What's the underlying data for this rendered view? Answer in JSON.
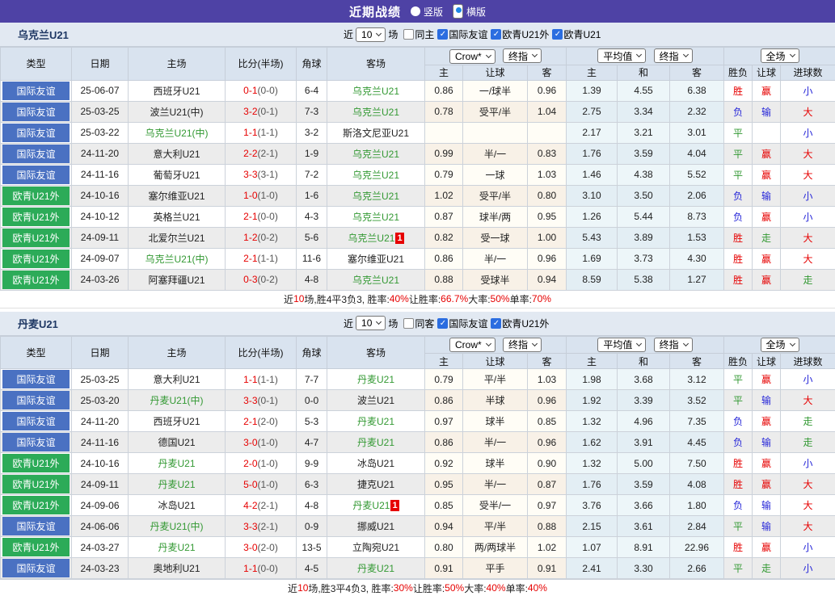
{
  "header": {
    "title": "近期战绩",
    "radio_vertical": "竖版",
    "radio_horizontal": "横版"
  },
  "controls": {
    "crow": "Crow*",
    "final_odds": "终指",
    "average": "平均值",
    "full_match": "全场"
  },
  "columns": {
    "type": "类型",
    "date": "日期",
    "home": "主场",
    "score": "比分(半场)",
    "corner": "角球",
    "away": "客场",
    "odds_home": "主",
    "odds_handicap": "让球",
    "odds_away": "客",
    "avg_home": "主",
    "avg_draw": "和",
    "avg_away": "客",
    "result_wdl": "胜负",
    "result_handicap": "让球",
    "result_goals": "进球数"
  },
  "colors": {
    "accent_purple": "#4e42a5",
    "type_blue": "#4a71c2",
    "type_green": "#2cab58",
    "focus_team_green": "#339933",
    "score_red": "#e60000",
    "result_red": "#e60000",
    "result_blue": "#2626d8",
    "result_green": "#339933",
    "header_bg": "#d9e3ef"
  },
  "tables": [
    {
      "team": "乌克兰U21",
      "filters": {
        "prefix": "近",
        "count": "10",
        "suffix": "场",
        "checks": [
          {
            "label": "同主",
            "checked": false
          },
          {
            "label": "国际友谊",
            "checked": true
          },
          {
            "label": "欧青U21外",
            "checked": true
          },
          {
            "label": "欧青U21",
            "checked": true
          }
        ]
      },
      "rows": [
        {
          "type": "国际友谊",
          "type_style": "blue",
          "date": "25-06-07",
          "home": "西班牙U21",
          "home_focus": false,
          "home_card": "",
          "score": "0-1",
          "half": "(0-0)",
          "corner": "6-4",
          "away": "乌克兰U21",
          "away_focus": true,
          "away_card": "",
          "crow_home": "0.86",
          "crow_hcp": "一/球半",
          "crow_away": "0.96",
          "avg_home": "1.39",
          "avg_draw": "4.55",
          "avg_away": "6.38",
          "wdl": "胜",
          "wdl_c": "r",
          "hcp": "赢",
          "hcp_c": "r",
          "goal": "小",
          "goal_c": "b"
        },
        {
          "type": "国际友谊",
          "type_style": "blue",
          "date": "25-03-25",
          "home": "波兰U21(中)",
          "home_focus": false,
          "home_card": "",
          "score": "3-2",
          "half": "(0-1)",
          "corner": "7-3",
          "away": "乌克兰U21",
          "away_focus": true,
          "away_card": "",
          "crow_home": "0.78",
          "crow_hcp": "受平/半",
          "crow_away": "1.04",
          "avg_home": "2.75",
          "avg_draw": "3.34",
          "avg_away": "2.32",
          "wdl": "负",
          "wdl_c": "b",
          "hcp": "输",
          "hcp_c": "b",
          "goal": "大",
          "goal_c": "r"
        },
        {
          "type": "国际友谊",
          "type_style": "blue",
          "date": "25-03-22",
          "home": "乌克兰U21(中)",
          "home_focus": true,
          "home_card": "",
          "score": "1-1",
          "half": "(1-1)",
          "corner": "3-2",
          "away": "斯洛文尼亚U21",
          "away_focus": false,
          "away_card": "",
          "crow_home": "",
          "crow_hcp": "",
          "crow_away": "",
          "avg_home": "2.17",
          "avg_draw": "3.21",
          "avg_away": "3.01",
          "wdl": "平",
          "wdl_c": "g",
          "hcp": "",
          "hcp_c": "r",
          "goal": "小",
          "goal_c": "b"
        },
        {
          "type": "国际友谊",
          "type_style": "blue",
          "date": "24-11-20",
          "home": "意大利U21",
          "home_focus": false,
          "home_card": "",
          "score": "2-2",
          "half": "(2-1)",
          "corner": "1-9",
          "away": "乌克兰U21",
          "away_focus": true,
          "away_card": "",
          "crow_home": "0.99",
          "crow_hcp": "半/一",
          "crow_away": "0.83",
          "avg_home": "1.76",
          "avg_draw": "3.59",
          "avg_away": "4.04",
          "wdl": "平",
          "wdl_c": "g",
          "hcp": "赢",
          "hcp_c": "r",
          "goal": "大",
          "goal_c": "r"
        },
        {
          "type": "国际友谊",
          "type_style": "blue",
          "date": "24-11-16",
          "home": "葡萄牙U21",
          "home_focus": false,
          "home_card": "",
          "score": "3-3",
          "half": "(3-1)",
          "corner": "7-2",
          "away": "乌克兰U21",
          "away_focus": true,
          "away_card": "",
          "crow_home": "0.79",
          "crow_hcp": "一球",
          "crow_away": "1.03",
          "avg_home": "1.46",
          "avg_draw": "4.38",
          "avg_away": "5.52",
          "wdl": "平",
          "wdl_c": "g",
          "hcp": "赢",
          "hcp_c": "r",
          "goal": "大",
          "goal_c": "r"
        },
        {
          "type": "欧青U21外",
          "type_style": "green",
          "date": "24-10-16",
          "home": "塞尔维亚U21",
          "home_focus": false,
          "home_card": "",
          "score": "1-0",
          "half": "(1-0)",
          "corner": "1-6",
          "away": "乌克兰U21",
          "away_focus": true,
          "away_card": "",
          "crow_home": "1.02",
          "crow_hcp": "受平/半",
          "crow_away": "0.80",
          "avg_home": "3.10",
          "avg_draw": "3.50",
          "avg_away": "2.06",
          "wdl": "负",
          "wdl_c": "b",
          "hcp": "输",
          "hcp_c": "b",
          "goal": "小",
          "goal_c": "b"
        },
        {
          "type": "欧青U21外",
          "type_style": "green",
          "date": "24-10-12",
          "home": "英格兰U21",
          "home_focus": false,
          "home_card": "",
          "score": "2-1",
          "half": "(0-0)",
          "corner": "4-3",
          "away": "乌克兰U21",
          "away_focus": true,
          "away_card": "",
          "crow_home": "0.87",
          "crow_hcp": "球半/两",
          "crow_away": "0.95",
          "avg_home": "1.26",
          "avg_draw": "5.44",
          "avg_away": "8.73",
          "wdl": "负",
          "wdl_c": "b",
          "hcp": "赢",
          "hcp_c": "r",
          "goal": "小",
          "goal_c": "b"
        },
        {
          "type": "欧青U21外",
          "type_style": "green",
          "date": "24-09-11",
          "home": "北爱尔兰U21",
          "home_focus": false,
          "home_card": "",
          "score": "1-2",
          "half": "(0-2)",
          "corner": "5-6",
          "away": "乌克兰U21",
          "away_focus": true,
          "away_card": "1",
          "crow_home": "0.82",
          "crow_hcp": "受一球",
          "crow_away": "1.00",
          "avg_home": "5.43",
          "avg_draw": "3.89",
          "avg_away": "1.53",
          "wdl": "胜",
          "wdl_c": "r",
          "hcp": "走",
          "hcp_c": "g",
          "goal": "大",
          "goal_c": "r"
        },
        {
          "type": "欧青U21外",
          "type_style": "green",
          "date": "24-09-07",
          "home": "乌克兰U21(中)",
          "home_focus": true,
          "home_card": "",
          "score": "2-1",
          "half": "(1-1)",
          "corner": "11-6",
          "away": "塞尔维亚U21",
          "away_focus": false,
          "away_card": "",
          "crow_home": "0.86",
          "crow_hcp": "半/一",
          "crow_away": "0.96",
          "avg_home": "1.69",
          "avg_draw": "3.73",
          "avg_away": "4.30",
          "wdl": "胜",
          "wdl_c": "r",
          "hcp": "赢",
          "hcp_c": "r",
          "goal": "大",
          "goal_c": "r"
        },
        {
          "type": "欧青U21外",
          "type_style": "green",
          "date": "24-03-26",
          "home": "阿塞拜疆U21",
          "home_focus": false,
          "home_card": "",
          "score": "0-3",
          "half": "(0-2)",
          "corner": "4-8",
          "away": "乌克兰U21",
          "away_focus": true,
          "away_card": "",
          "crow_home": "0.88",
          "crow_hcp": "受球半",
          "crow_away": "0.94",
          "avg_home": "8.59",
          "avg_draw": "5.38",
          "avg_away": "1.27",
          "wdl": "胜",
          "wdl_c": "r",
          "hcp": "赢",
          "hcp_c": "r",
          "goal": "走",
          "goal_c": "g"
        }
      ],
      "summary": [
        {
          "text": "近"
        },
        {
          "text": "10",
          "red": true
        },
        {
          "text": "场,胜4平3负3, 胜率:"
        },
        {
          "text": "40%",
          "red": true
        },
        {
          "text": " 让胜率:"
        },
        {
          "text": "66.7%",
          "red": true
        },
        {
          "text": " 大率:"
        },
        {
          "text": "50%",
          "red": true
        },
        {
          "text": " 单率:"
        },
        {
          "text": "70%",
          "red": true
        }
      ]
    },
    {
      "team": "丹麦U21",
      "filters": {
        "prefix": "近",
        "count": "10",
        "suffix": "场",
        "checks": [
          {
            "label": "同客",
            "checked": false
          },
          {
            "label": "国际友谊",
            "checked": true
          },
          {
            "label": "欧青U21外",
            "checked": true
          }
        ]
      },
      "rows": [
        {
          "type": "国际友谊",
          "type_style": "blue",
          "date": "25-03-25",
          "home": "意大利U21",
          "home_focus": false,
          "home_card": "",
          "score": "1-1",
          "half": "(1-1)",
          "corner": "7-7",
          "away": "丹麦U21",
          "away_focus": true,
          "away_card": "",
          "crow_home": "0.79",
          "crow_hcp": "平/半",
          "crow_away": "1.03",
          "avg_home": "1.98",
          "avg_draw": "3.68",
          "avg_away": "3.12",
          "wdl": "平",
          "wdl_c": "g",
          "hcp": "赢",
          "hcp_c": "r",
          "goal": "小",
          "goal_c": "b"
        },
        {
          "type": "国际友谊",
          "type_style": "blue",
          "date": "25-03-20",
          "home": "丹麦U21(中)",
          "home_focus": true,
          "home_card": "",
          "score": "3-3",
          "half": "(0-1)",
          "corner": "0-0",
          "away": "波兰U21",
          "away_focus": false,
          "away_card": "",
          "crow_home": "0.86",
          "crow_hcp": "半球",
          "crow_away": "0.96",
          "avg_home": "1.92",
          "avg_draw": "3.39",
          "avg_away": "3.52",
          "wdl": "平",
          "wdl_c": "g",
          "hcp": "输",
          "hcp_c": "b",
          "goal": "大",
          "goal_c": "r"
        },
        {
          "type": "国际友谊",
          "type_style": "blue",
          "date": "24-11-20",
          "home": "西班牙U21",
          "home_focus": false,
          "home_card": "",
          "score": "2-1",
          "half": "(2-0)",
          "corner": "5-3",
          "away": "丹麦U21",
          "away_focus": true,
          "away_card": "",
          "crow_home": "0.97",
          "crow_hcp": "球半",
          "crow_away": "0.85",
          "avg_home": "1.32",
          "avg_draw": "4.96",
          "avg_away": "7.35",
          "wdl": "负",
          "wdl_c": "b",
          "hcp": "赢",
          "hcp_c": "r",
          "goal": "走",
          "goal_c": "g"
        },
        {
          "type": "国际友谊",
          "type_style": "blue",
          "date": "24-11-16",
          "home": "德国U21",
          "home_focus": false,
          "home_card": "",
          "score": "3-0",
          "half": "(1-0)",
          "corner": "4-7",
          "away": "丹麦U21",
          "away_focus": true,
          "away_card": "",
          "crow_home": "0.86",
          "crow_hcp": "半/一",
          "crow_away": "0.96",
          "avg_home": "1.62",
          "avg_draw": "3.91",
          "avg_away": "4.45",
          "wdl": "负",
          "wdl_c": "b",
          "hcp": "输",
          "hcp_c": "b",
          "goal": "走",
          "goal_c": "g"
        },
        {
          "type": "欧青U21外",
          "type_style": "green",
          "date": "24-10-16",
          "home": "丹麦U21",
          "home_focus": true,
          "home_card": "",
          "score": "2-0",
          "half": "(1-0)",
          "corner": "9-9",
          "away": "冰岛U21",
          "away_focus": false,
          "away_card": "",
          "crow_home": "0.92",
          "crow_hcp": "球半",
          "crow_away": "0.90",
          "avg_home": "1.32",
          "avg_draw": "5.00",
          "avg_away": "7.50",
          "wdl": "胜",
          "wdl_c": "r",
          "hcp": "赢",
          "hcp_c": "r",
          "goal": "小",
          "goal_c": "b"
        },
        {
          "type": "欧青U21外",
          "type_style": "green",
          "date": "24-09-11",
          "home": "丹麦U21",
          "home_focus": true,
          "home_card": "",
          "score": "5-0",
          "half": "(1-0)",
          "corner": "6-3",
          "away": "捷克U21",
          "away_focus": false,
          "away_card": "",
          "crow_home": "0.95",
          "crow_hcp": "半/一",
          "crow_away": "0.87",
          "avg_home": "1.76",
          "avg_draw": "3.59",
          "avg_away": "4.08",
          "wdl": "胜",
          "wdl_c": "r",
          "hcp": "赢",
          "hcp_c": "r",
          "goal": "大",
          "goal_c": "r"
        },
        {
          "type": "欧青U21外",
          "type_style": "green",
          "date": "24-09-06",
          "home": "冰岛U21",
          "home_focus": false,
          "home_card": "",
          "score": "4-2",
          "half": "(2-1)",
          "corner": "4-8",
          "away": "丹麦U21",
          "away_focus": true,
          "away_card": "1",
          "crow_home": "0.85",
          "crow_hcp": "受半/一",
          "crow_away": "0.97",
          "avg_home": "3.76",
          "avg_draw": "3.66",
          "avg_away": "1.80",
          "wdl": "负",
          "wdl_c": "b",
          "hcp": "输",
          "hcp_c": "b",
          "goal": "大",
          "goal_c": "r"
        },
        {
          "type": "国际友谊",
          "type_style": "blue",
          "date": "24-06-06",
          "home": "丹麦U21(中)",
          "home_focus": true,
          "home_card": "",
          "score": "3-3",
          "half": "(2-1)",
          "corner": "0-9",
          "away": "挪威U21",
          "away_focus": false,
          "away_card": "",
          "crow_home": "0.94",
          "crow_hcp": "平/半",
          "crow_away": "0.88",
          "avg_home": "2.15",
          "avg_draw": "3.61",
          "avg_away": "2.84",
          "wdl": "平",
          "wdl_c": "g",
          "hcp": "输",
          "hcp_c": "b",
          "goal": "大",
          "goal_c": "r"
        },
        {
          "type": "欧青U21外",
          "type_style": "green",
          "date": "24-03-27",
          "home": "丹麦U21",
          "home_focus": true,
          "home_card": "",
          "score": "3-0",
          "half": "(2-0)",
          "corner": "13-5",
          "away": "立陶宛U21",
          "away_focus": false,
          "away_card": "",
          "crow_home": "0.80",
          "crow_hcp": "两/两球半",
          "crow_away": "1.02",
          "avg_home": "1.07",
          "avg_draw": "8.91",
          "avg_away": "22.96",
          "wdl": "胜",
          "wdl_c": "r",
          "hcp": "赢",
          "hcp_c": "r",
          "goal": "小",
          "goal_c": "b"
        },
        {
          "type": "国际友谊",
          "type_style": "blue",
          "date": "24-03-23",
          "home": "奥地利U21",
          "home_focus": false,
          "home_card": "",
          "score": "1-1",
          "half": "(0-0)",
          "corner": "4-5",
          "away": "丹麦U21",
          "away_focus": true,
          "away_card": "",
          "crow_home": "0.91",
          "crow_hcp": "平手",
          "crow_away": "0.91",
          "avg_home": "2.41",
          "avg_draw": "3.30",
          "avg_away": "2.66",
          "wdl": "平",
          "wdl_c": "g",
          "hcp": "走",
          "hcp_c": "g",
          "goal": "小",
          "goal_c": "b"
        }
      ],
      "summary": [
        {
          "text": "近"
        },
        {
          "text": "10",
          "red": true
        },
        {
          "text": "场,胜3平4负3, 胜率:"
        },
        {
          "text": "30%",
          "red": true
        },
        {
          "text": " 让胜率:"
        },
        {
          "text": "50%",
          "red": true
        },
        {
          "text": " 大率:"
        },
        {
          "text": "40%",
          "red": true
        },
        {
          "text": " 单率:"
        },
        {
          "text": "40%",
          "red": true
        }
      ]
    }
  ]
}
